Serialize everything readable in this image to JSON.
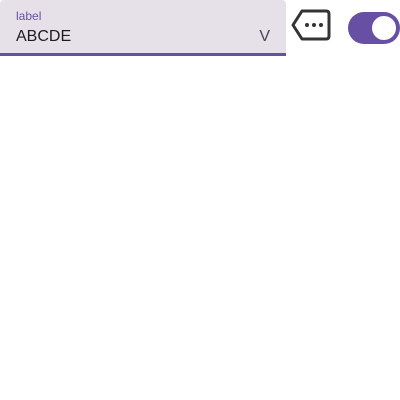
{
  "dropdown": {
    "label": "label",
    "value": "ABCDE",
    "arrow": "V"
  },
  "icons": {
    "tag": "tag-more-icon"
  },
  "toggle": {
    "state": "on"
  },
  "colors": {
    "accent": "#6750a4",
    "field_background": "#e6e0e9",
    "text": "#1d1b20"
  }
}
